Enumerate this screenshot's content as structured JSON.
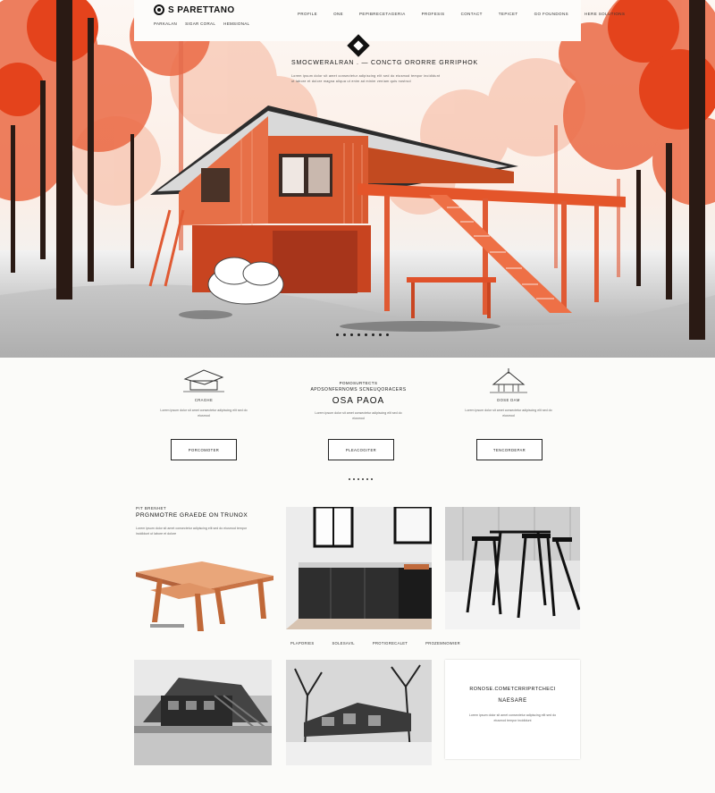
{
  "header": {
    "logo_text": "S PARETTANO",
    "sublinks": [
      "PARKALAN",
      "SIGAR CORAL",
      "HEMSIONAL"
    ],
    "nav": [
      "PROFILE",
      "ONE",
      "PEPIBRECETAGERIA",
      "PROFESIS",
      "CONTACT",
      "TEPICET",
      "GO FOUNDONS",
      "HERE SOLUTIONS"
    ]
  },
  "hero": {
    "title": "SMOCWERALRAN . — CONCTG ORORRE GRRIPHOK",
    "subtitle": "Lorem ipsum dolor sit amet consectetur adipiscing elit sed do eiusmod tempor incididunt ut labore et dolore magna aliqua ut enim ad minim veniam quis nostrud",
    "slide_count": 8,
    "active_slide": 0
  },
  "features": [
    {
      "label": "CRAGHE",
      "text": "Lorem ipsum dolor sit amet consectetur adipiscing elit sed do eiusmod",
      "button": "PORCOMOTER"
    },
    {
      "head1": "POMOSURTECTS",
      "head2": "APDSONFERNOMS SCNEUQORACERS",
      "big": "OSA PAOA",
      "text": "Lorem ipsum dolor sit amet consectetur adipiscing elit sed do eiusmod",
      "button": "PLEACOGITER"
    },
    {
      "label": "DOSE DAM",
      "text": "Lorem ipsum dolor sit amet consectetur adipiscing elit sed do eiusmod",
      "button": "TENCORDEPAR"
    }
  ],
  "gallery": {
    "intro_small": "PIT BRENHET",
    "intro_big": "PRGNMOTRE GRAEDE ON TRUNOX",
    "intro_text": "Lorem ipsum dolor sit amet consectetur adipiscing elit sed do eiusmod tempor incididunt ut labore et dolore",
    "filters": [
      "PLAPORIES",
      "SOLESAVIL",
      "PROTIGRECALET",
      "PROZEMNOWIER"
    ],
    "card": {
      "heading": "RONOSE.COMETCRRIPRTCHECI",
      "subheading": "NAESARE",
      "text": "Lorem ipsum dolor sit amet consectetur adipiscing elit sed do eiusmod tempor incididunt"
    }
  },
  "colors": {
    "accent": "#e0401c",
    "dark": "#111111",
    "page_bg": "#fbfbf9"
  }
}
